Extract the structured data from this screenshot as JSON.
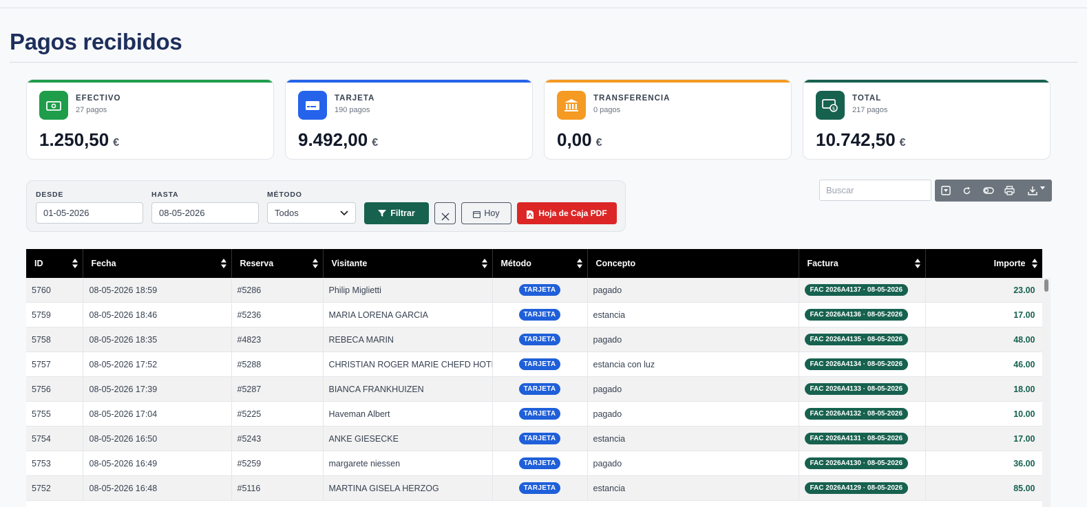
{
  "page": {
    "title": "Pagos recibidos"
  },
  "cards": [
    {
      "label": "EFECTIVO",
      "count": "27 pagos",
      "amount": "1.250,50",
      "currency": "€",
      "color": "#1f9d4a",
      "icon": "cash-icon"
    },
    {
      "label": "TARJETA",
      "count": "190 pagos",
      "amount": "9.492,00",
      "currency": "€",
      "color": "#2563eb",
      "icon": "credit-card-icon"
    },
    {
      "label": "TRANSFERENCIA",
      "count": "0 pagos",
      "amount": "0,00",
      "currency": "€",
      "color": "#f59a23",
      "icon": "bank-icon"
    },
    {
      "label": "TOTAL",
      "count": "217 pagos",
      "amount": "10.742,50",
      "currency": "€",
      "color": "#17614f",
      "icon": "money-total-icon"
    }
  ],
  "filters": {
    "desde_label": "DESDE",
    "desde_value": "01-05-2026",
    "hasta_label": "HASTA",
    "hasta_value": "08-05-2026",
    "metodo_label": "MÉTODO",
    "metodo_value": "Todos",
    "filtrar_label": "Filtrar",
    "hoy_label": "Hoy",
    "pdf_label": "Hoja de Caja PDF"
  },
  "search": {
    "placeholder": "Buscar"
  },
  "table": {
    "columns": [
      "ID",
      "Fecha",
      "Reserva",
      "Visitante",
      "Método",
      "Concepto",
      "Factura",
      "Importe"
    ],
    "rows": [
      [
        "5760",
        "08-05-2026 18:59",
        "#5286",
        "Philip Miglietti",
        "TARJETA",
        "pagado",
        "FAC 2026A4137 · 08-05-2026",
        "23.00"
      ],
      [
        "5759",
        "08-05-2026 18:46",
        "#5236",
        "MARIA LORENA GARCIA",
        "TARJETA",
        "estancia",
        "FAC 2026A4136 · 08-05-2026",
        "17.00"
      ],
      [
        "5758",
        "08-05-2026 18:35",
        "#4823",
        "REBECA MARIN",
        "TARJETA",
        "pagado",
        "FAC 2026A4135 · 08-05-2026",
        "48.00"
      ],
      [
        "5757",
        "08-05-2026 17:52",
        "#5288",
        "CHRISTIAN ROGER MARIE CHEFD HOTEL",
        "TARJETA",
        "estancia con luz",
        "FAC 2026A4134 · 08-05-2026",
        "46.00"
      ],
      [
        "5756",
        "08-05-2026 17:39",
        "#5287",
        "BIANCA FRANKHUIZEN",
        "TARJETA",
        "pagado",
        "FAC 2026A4133 · 08-05-2026",
        "18.00"
      ],
      [
        "5755",
        "08-05-2026 17:04",
        "#5225",
        "Haveman Albert",
        "TARJETA",
        "pagado",
        "FAC 2026A4132 · 08-05-2026",
        "10.00"
      ],
      [
        "5754",
        "08-05-2026 16:50",
        "#5243",
        "ANKE GIESECKE",
        "TARJETA",
        "estancia",
        "FAC 2026A4131 · 08-05-2026",
        "17.00"
      ],
      [
        "5753",
        "08-05-2026 16:49",
        "#5259",
        "margarete niessen",
        "TARJETA",
        "pagado",
        "FAC 2026A4130 · 08-05-2026",
        "36.00"
      ],
      [
        "5752",
        "08-05-2026 16:48",
        "#5116",
        "MARTINA GISELA HERZOG",
        "TARJETA",
        "estancia",
        "FAC 2026A4129 · 08-05-2026",
        "85.00"
      ]
    ]
  }
}
